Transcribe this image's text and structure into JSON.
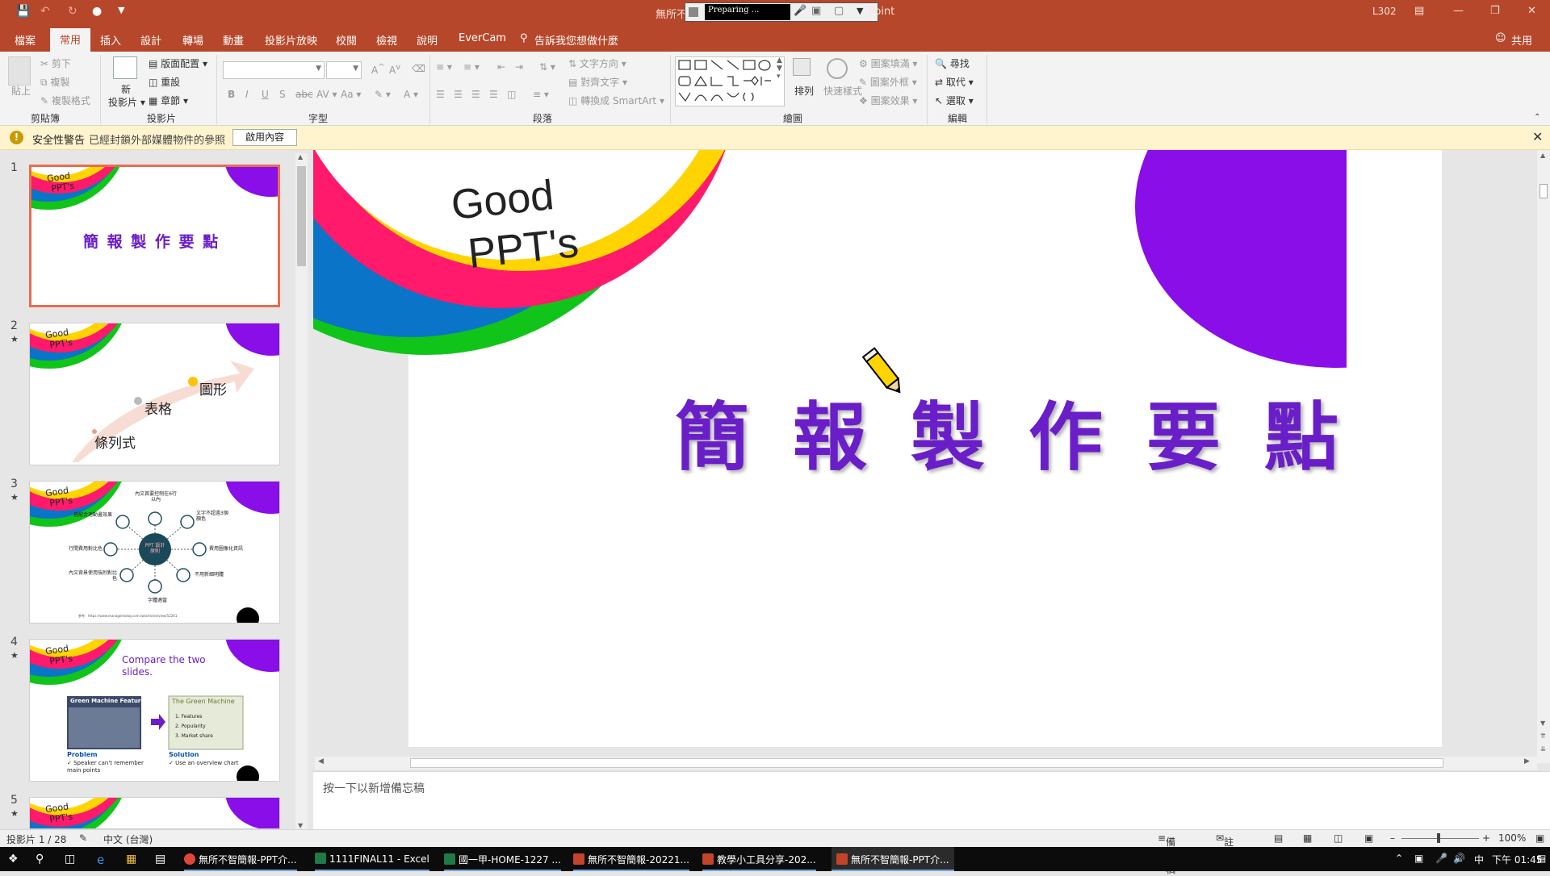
{
  "titlebar": {
    "doc_title_prefix": "無所不",
    "preparing": "Preparing ...",
    "app_suffix": "Point",
    "user": "L302"
  },
  "tabs": [
    "檔案",
    "常用",
    "插入",
    "設計",
    "轉場",
    "動畫",
    "投影片放映",
    "校閱",
    "檢視",
    "說明",
    "EverCam"
  ],
  "tell_me": "告訴我您想做什麼",
  "share": "共用",
  "ribbon": {
    "clipboard": {
      "label": "剪貼簿",
      "paste": "貼上",
      "cut": "剪下",
      "copy": "複製",
      "format_painter": "複製格式"
    },
    "slides": {
      "label": "投影片",
      "new_slide": "新\n投影片",
      "layout": "版面配置",
      "reset": "重設",
      "section": "章節"
    },
    "font": {
      "label": "字型"
    },
    "paragraph": {
      "label": "段落",
      "text_direction": "文字方向",
      "align_text": "對齊文字",
      "smartart": "轉換成 SmartArt"
    },
    "drawing": {
      "label": "繪圖",
      "arrange": "排列",
      "quick_styles": "快速樣式",
      "shape_fill": "圖案填滿",
      "shape_outline": "圖案外框",
      "shape_effects": "圖案效果"
    },
    "editing": {
      "label": "編輯",
      "find": "尋找",
      "replace": "取代",
      "select": "選取"
    }
  },
  "security": {
    "title": "安全性警告",
    "message": "已經封鎖外部媒體物件的參照",
    "button": "啟用內容"
  },
  "thumbnails": [
    {
      "num": "1",
      "good": "Good",
      "ppt": "PPT's",
      "title": "簡 報 製 作 要 點"
    },
    {
      "num": "2",
      "good": "Good",
      "ppt": "PPT's",
      "labels": [
        "表格",
        "圖形",
        "條列式"
      ]
    },
    {
      "num": "3",
      "good": "Good",
      "ppt": "PPT's",
      "center": "PPT 設計原則",
      "items": [
        "內文首要控制在6行以內",
        "文字不超過3個顏色",
        "費用圖像化資訊",
        "不用新細明體",
        "字體適當",
        "內文背景使用強烈對比色",
        "行間費用對比色",
        "搭配合適動畫效果"
      ],
      "footer": "參考：https://www.managertoday.com.tw/articles/view/52261"
    },
    {
      "num": "4",
      "good": "Good",
      "ppt": "PPT's",
      "heading": "Compare the two slides.",
      "left_title": "Green Machine Features",
      "right_title": "The Green Machine",
      "right_items": [
        "1. Features",
        "2. Popularity",
        "3. Market share"
      ],
      "problem": "Problem",
      "problem_text": "Speaker can't remember main points",
      "solution": "Solution",
      "solution_text": "Use an overview chart"
    },
    {
      "num": "5",
      "good": "Good",
      "ppt": "PPT's"
    }
  ],
  "slide": {
    "good": "Good",
    "ppt": "PPT's",
    "title_chars": [
      "簡",
      "報",
      "製",
      "作",
      "要",
      "點"
    ]
  },
  "notes_placeholder": "按一下以新增備忘稿",
  "status": {
    "slide_counter": "投影片 1 / 28",
    "language": "中文 (台灣)",
    "notes": "備忘稿",
    "comments": "註解",
    "zoom": "100%"
  },
  "taskbar": {
    "tasks": [
      "無所不智簡報-PPT介...",
      "1111FINAL11 - Excel",
      "國一甲-HOME-1227 ...",
      "無所不智簡報-20221...",
      "教學小工具分享-202...",
      "無所不智簡報-PPT介..."
    ],
    "ime": "中",
    "time": "下午 01:45"
  },
  "colors": {
    "accent": "#b7472a",
    "purple": "#6a1ec8",
    "violet": "#8a0ee8",
    "pink": "#ff1a6b",
    "blue": "#0a74c9",
    "green": "#10c41a",
    "yellow": "#ffd400"
  }
}
